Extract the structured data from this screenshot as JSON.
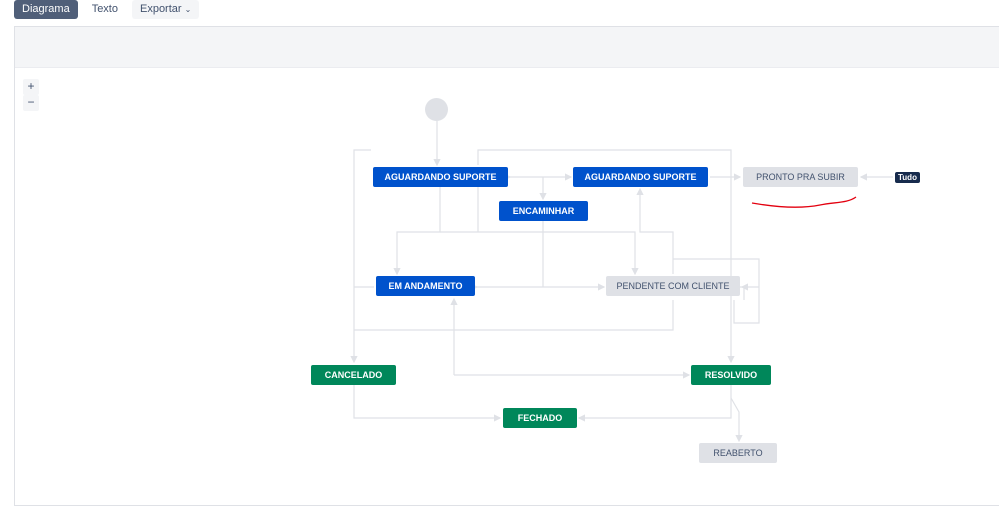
{
  "tabs": {
    "diagram": "Diagrama",
    "text": "Texto",
    "export": "Exportar",
    "export_chevron": "⌄"
  },
  "zoom": {
    "in": "+",
    "out": "−"
  },
  "statuses": {
    "aguardando_suporte_1": "AGUARDANDO SUPORTE",
    "aguardando_suporte_2": "AGUARDANDO SUPORTE",
    "pronto_pra_subir": "PRONTO PRA SUBIR",
    "encaminhar": "ENCAMINHAR",
    "em_andamento": "EM ANDAMENTO",
    "pendente_com_cliente": "PENDENTE COM CLIENTE",
    "cancelado": "CANCELADO",
    "resolvido": "RESOLVIDO",
    "fechado": "FECHADO",
    "reaberto": "REABERTO"
  },
  "global_transition_label": "Tudo",
  "colors": {
    "in_progress": "#0052cc",
    "todo": "#dfe1e6",
    "done": "#00875a",
    "connector": "#dfe1e6",
    "annotation": "#e3000f"
  }
}
